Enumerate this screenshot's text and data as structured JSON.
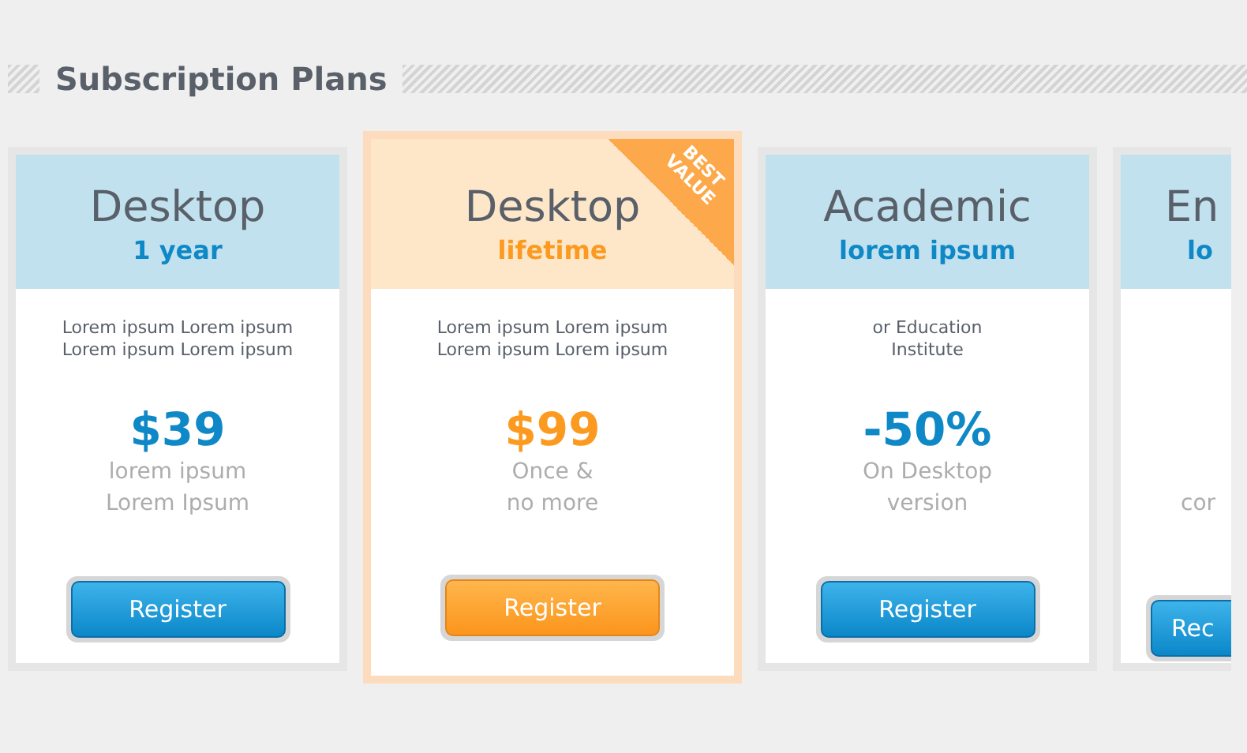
{
  "heading": "Subscription Plans",
  "plans": [
    {
      "title": "Desktop",
      "subtitle": "1 year",
      "description": "Lorem ipsum Lorem ipsum\nLorem ipsum Lorem ipsum",
      "price": "$39",
      "note": "lorem ipsum\nLorem Ipsum",
      "button": "Register",
      "featured": false,
      "cut": false
    },
    {
      "title": "Desktop",
      "subtitle": "lifetime",
      "description": "Lorem ipsum Lorem ipsum\nLorem ipsum Lorem ipsum",
      "price": "$99",
      "note": "Once &\nno more",
      "button": "Register",
      "featured": true,
      "badge": "BEST VALUE",
      "cut": false
    },
    {
      "title": "Academic",
      "subtitle": "lorem ipsum",
      "description": "or Education\nInstitute",
      "price": "-50%",
      "note": "On Desktop\nversion",
      "button": "Register",
      "featured": false,
      "cut": false
    },
    {
      "title": "En",
      "subtitle": "lo",
      "note": "cor",
      "button": "Rec",
      "featured": false,
      "cut": true
    }
  ]
}
